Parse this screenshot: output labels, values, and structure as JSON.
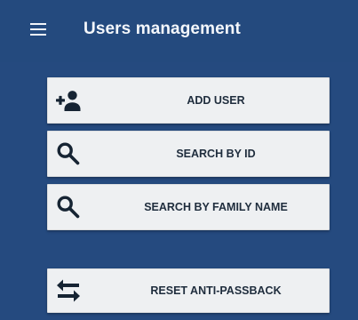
{
  "header": {
    "title": "Users management",
    "menu_icon": "hamburger-menu-icon"
  },
  "actions": [
    {
      "label": "ADD USER",
      "icon": "add-user-icon"
    },
    {
      "label": "SEARCH BY ID",
      "icon": "search-icon"
    },
    {
      "label": "SEARCH BY FAMILY NAME",
      "icon": "search-icon"
    },
    {
      "label": "RESET ANTI-PASSBACK",
      "icon": "swap-arrows-icon"
    }
  ],
  "colors": {
    "background": "#254a7f",
    "button": "#eef0f2",
    "button_text": "#1f2d3d",
    "header_text": "#f4f7fb"
  }
}
